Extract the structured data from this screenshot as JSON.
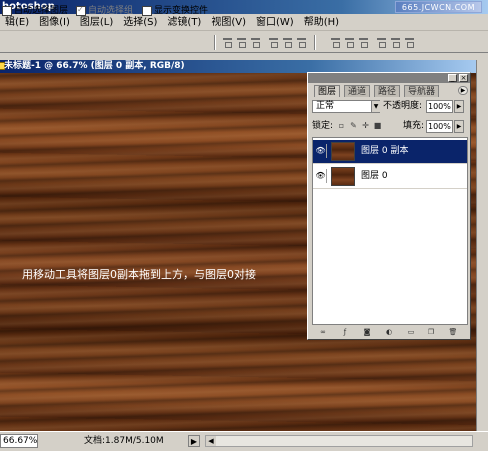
{
  "app": {
    "title": "hotoshop",
    "watermark": "665.JCWCN.COM"
  },
  "menu": [
    "辑(E)",
    "图像(I)",
    "图层(L)",
    "选择(S)",
    "滤镜(T)",
    "视图(V)",
    "窗口(W)",
    "帮助(H)"
  ],
  "options": {
    "auto_select_layer": "自动选择图层",
    "auto_select_group": "自动选择组",
    "show_transform": "显示变换控件"
  },
  "document": {
    "title": "未标题-1 @ 66.7% (图层 0 副本, RGB/8)",
    "hint": "用移动工具将图层0副本拖到上方，与图层0对接"
  },
  "status": {
    "zoom": "66.67%",
    "doc_size": "文档:1.87M/5.10M"
  },
  "layers_palette": {
    "tabs": [
      "图层",
      "通道",
      "路径",
      "导航器"
    ],
    "blend_mode": "正常",
    "opacity_label": "不透明度:",
    "opacity_value": "100%",
    "lock_label": "锁定:",
    "fill_label": "填充:",
    "fill_value": "100%",
    "layers": [
      {
        "name": "图层 0 副本",
        "selected": true
      },
      {
        "name": "图层 0",
        "selected": false
      }
    ]
  }
}
